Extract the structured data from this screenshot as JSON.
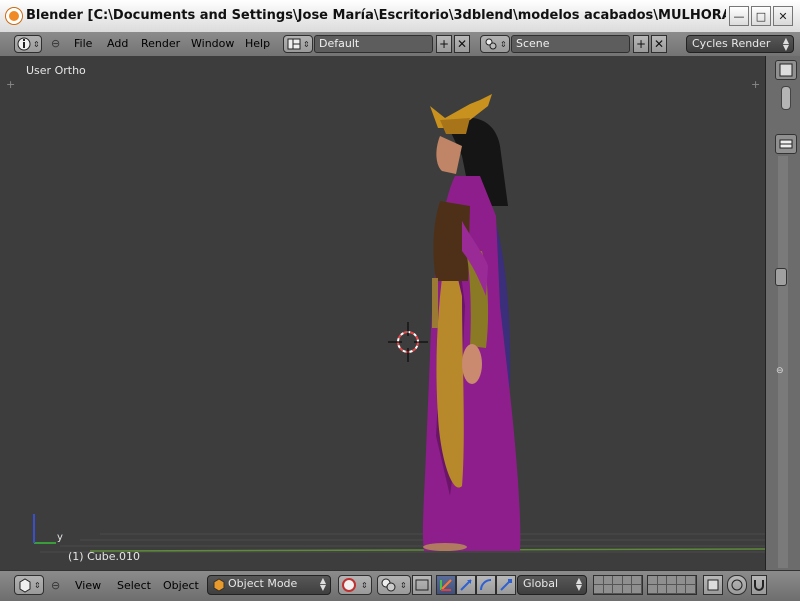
{
  "window": {
    "title": "Blender [C:\\Documents and Settings\\Jose María\\Escritorio\\3dblend\\modelos acabados\\MULHORAND\\clerigos\\cu...",
    "min_glyph": "—",
    "max_glyph": "□",
    "close_glyph": "✕"
  },
  "info_header": {
    "menus": [
      "File",
      "Add",
      "Render",
      "Window",
      "Help"
    ],
    "screen_layout": "Default",
    "scene": "Scene",
    "render_engine": "Cycles Render"
  },
  "viewport": {
    "view_label": "User Ortho",
    "object_label": "(1) Cube.010",
    "axis_y": "y"
  },
  "bottom_header": {
    "menus": [
      "View",
      "Select",
      "Object"
    ],
    "mode": "Object Mode",
    "orientation": "Global"
  },
  "colors": {
    "background": "#3d3d3d",
    "header": "#8c8c8c",
    "robe": "#8e1e8c",
    "headdress": "#c9921f"
  }
}
